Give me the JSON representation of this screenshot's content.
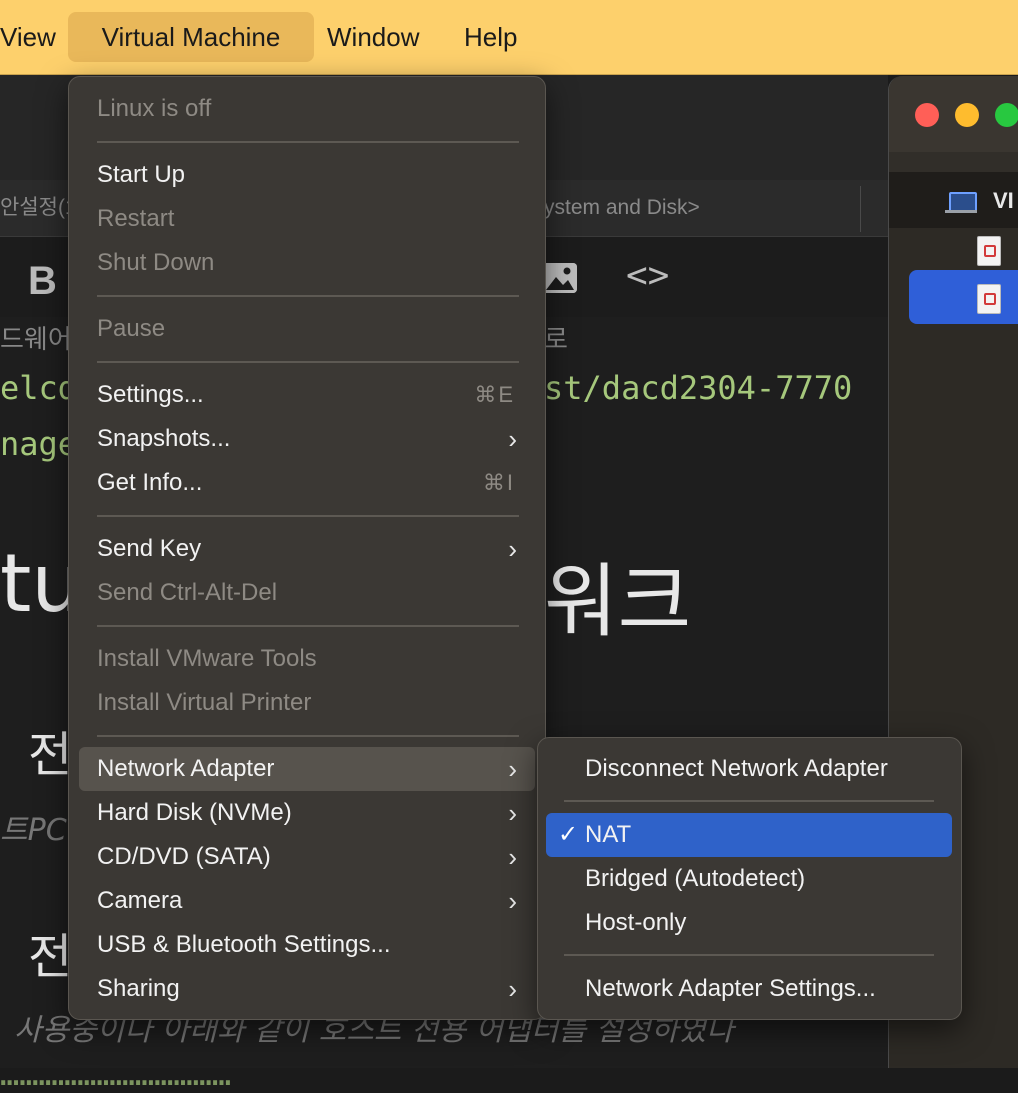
{
  "menubar": {
    "view": "View",
    "virtual_machine": "Virtual Machine",
    "window": "Window",
    "help": "Help"
  },
  "editor": {
    "tab_left": "안설정(1",
    "tab_right": "ystem and Disk>",
    "toolbar_bold": "B",
    "toolbar_code": "<>",
    "line_partial_top": "드웨어",
    "line_partial_top_right": "로",
    "code_line1_left": "elcd",
    "code_line1_right": "st/dacd2304-7770",
    "code_line2_left": "nage",
    "heading_left": "tu",
    "heading_right": "워크",
    "sub1": "전",
    "italic1": "트PC",
    "sub2": "전",
    "italic2": "사용중이다 아래와 같이 호스트 전용 어댑터를 설정하였다"
  },
  "vmwindow": {
    "title_partial": "VI"
  },
  "menu": {
    "status": "Linux is off",
    "start_up": "Start Up",
    "restart": "Restart",
    "shut_down": "Shut Down",
    "pause": "Pause",
    "settings": "Settings...",
    "settings_shortcut": "⌘E",
    "snapshots": "Snapshots...",
    "get_info": "Get Info...",
    "get_info_shortcut": "⌘I",
    "send_key": "Send Key",
    "send_ctrl_alt_del": "Send Ctrl-Alt-Del",
    "install_vmware_tools": "Install VMware Tools",
    "install_virtual_printer": "Install Virtual Printer",
    "network_adapter": "Network Adapter",
    "hard_disk": "Hard Disk (NVMe)",
    "cd_dvd": "CD/DVD (SATA)",
    "camera": "Camera",
    "usb_bluetooth": "USB & Bluetooth Settings...",
    "sharing": "Sharing"
  },
  "submenu": {
    "disconnect": "Disconnect Network Adapter",
    "nat": "NAT",
    "checkmark": "✓",
    "bridged": "Bridged (Autodetect)",
    "host_only": "Host-only",
    "adapter_settings": "Network Adapter Settings..."
  },
  "colors": {
    "menubar_bg": "#fdd06c",
    "menu_bg": "#3b3834",
    "selection_blue": "#2f62c9",
    "code_green": "#a6c87c"
  }
}
